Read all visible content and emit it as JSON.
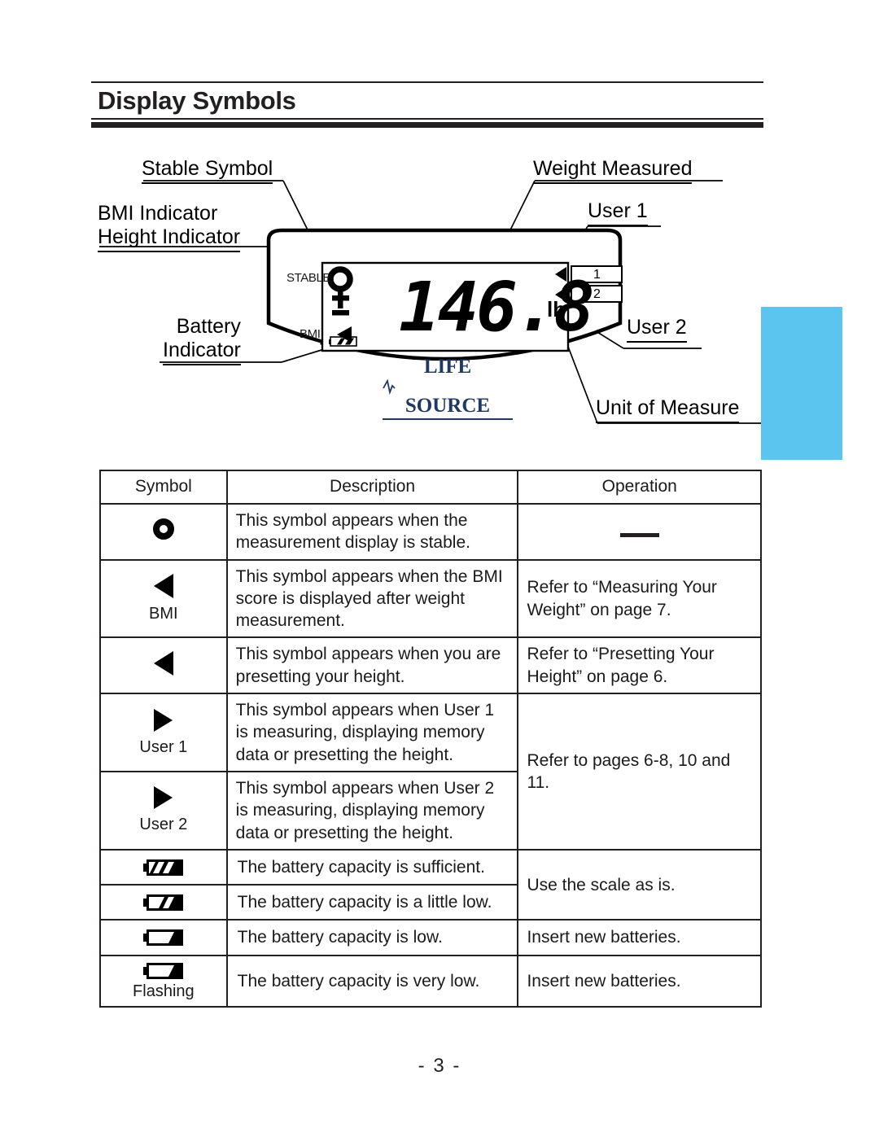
{
  "page": {
    "title": "Display Symbols",
    "footer": "- 3 -"
  },
  "diagram": {
    "callouts": {
      "stable_symbol": "Stable Symbol",
      "bmi_indicator": "BMI Indicator",
      "height_indicator": "Height Indicator",
      "weight_measured": "Weight Measured",
      "user_1": "User 1",
      "user_2": "User 2",
      "battery": "Battery",
      "indicator": "Indicator",
      "unit_of_measure": "Unit of Measure"
    },
    "lcd": {
      "stable_label": "STABLE",
      "bmi_label": "BMI",
      "reading": "146.8",
      "unit": "lb",
      "user_box_1": "1",
      "user_box_2": "2"
    },
    "brand": {
      "part_one": "LIFE",
      "part_two": "SOURCE",
      "color": "#1f3864"
    },
    "accent_box_color": "#5bc5f0"
  },
  "table": {
    "headers": [
      "Symbol",
      "Description",
      "Operation"
    ],
    "rows": [
      {
        "symbol_icon": "stable-ring-icon",
        "symbol_caption": "",
        "description": "This symbol appears when the measurement display is stable.",
        "operation": "",
        "operation_icon": "dash"
      },
      {
        "symbol_icon": "triangle-left-icon",
        "symbol_caption": "BMI",
        "description": "This symbol appears when the BMI score is displayed after weight measurement.",
        "operation": "Refer to “Measuring Your Weight” on page 7."
      },
      {
        "symbol_icon": "triangle-left-icon",
        "symbol_caption": "",
        "description": "This symbol appears when you are presetting your height.",
        "operation": "Refer to “Presetting Your Height” on page 6."
      },
      {
        "symbol_icon": "triangle-right-icon",
        "symbol_caption": "User 1",
        "description": "This symbol appears when User 1 is measuring, displaying memory data or presetting the height.",
        "operation": "Refer to pages 6-8, 10 and 11."
      },
      {
        "symbol_icon": "triangle-right-icon",
        "symbol_caption": "User 2",
        "description": "This symbol appears when User 2 is measuring, displaying memory data or presetting the height.",
        "operation": ""
      },
      {
        "symbol_icon": "battery-full-icon",
        "symbol_caption": "",
        "description": "The battery capacity is sufficient.",
        "operation": "Use the scale as is."
      },
      {
        "symbol_icon": "battery-two-thirds-icon",
        "symbol_caption": "",
        "description": "The battery capacity is a little low.",
        "operation": ""
      },
      {
        "symbol_icon": "battery-low-icon",
        "symbol_caption": "",
        "description": "The battery capacity is low.",
        "operation": "Insert new batteries."
      },
      {
        "symbol_icon": "battery-very-low-icon",
        "symbol_caption": "Flashing",
        "description": "The battery capacity is very low.",
        "operation": "Insert new batteries."
      }
    ]
  }
}
